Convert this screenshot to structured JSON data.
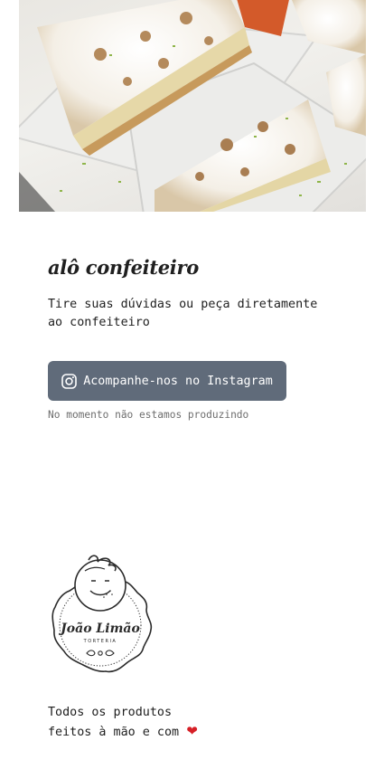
{
  "hero": {
    "image": "lemon meringue pie slices in plastic containers"
  },
  "contact": {
    "title": "alô confeiteiro",
    "description": "Tire suas dúvidas ou peça diretamente ao confeiteiro",
    "instagram_button_label": "Acompanhe-nos no Instagram",
    "instagram_icon": "instagram-icon",
    "status_note": "No momento não estamos produzindo"
  },
  "brand": {
    "name": "João Limão",
    "subtitle": "TORTERIA"
  },
  "footer": {
    "tagline_line1": "Todos os produtos",
    "tagline_line2": "feitos à mão e com ",
    "heart_icon": "heart-icon"
  }
}
